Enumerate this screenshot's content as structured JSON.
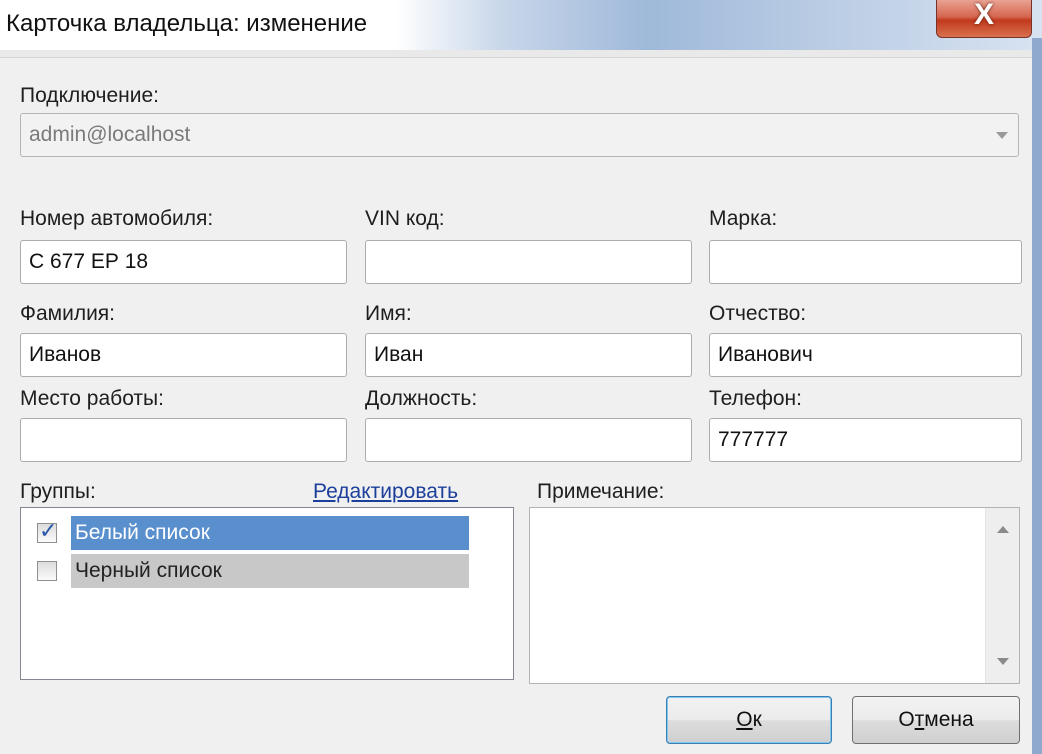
{
  "window": {
    "title": "Карточка владельца: изменение",
    "close_glyph": "X"
  },
  "connection": {
    "label": "Подключение:",
    "value": "admin@localhost"
  },
  "fields": {
    "car_number": {
      "label": "Номер автомобиля:",
      "value": "С 677 ЕР 18"
    },
    "vin": {
      "label": "VIN код:",
      "value": ""
    },
    "brand": {
      "label": "Марка:",
      "value": ""
    },
    "last_name": {
      "label": "Фамилия:",
      "value": "Иванов"
    },
    "first_name": {
      "label": "Имя:",
      "value": "Иван"
    },
    "patronymic": {
      "label": "Отчество:",
      "value": "Иванович"
    },
    "workplace": {
      "label": "Место работы:",
      "value": ""
    },
    "position": {
      "label": "Должность:",
      "value": ""
    },
    "phone": {
      "label": "Телефон:",
      "value": "777777"
    }
  },
  "groups": {
    "label": "Группы:",
    "edit_link": "Редактировать",
    "items": [
      {
        "label": "Белый список",
        "checked": true
      },
      {
        "label": "Черный список",
        "checked": false
      }
    ]
  },
  "notes": {
    "label": "Примечание:",
    "value": ""
  },
  "buttons": {
    "ok": {
      "mnemonic": "О",
      "rest": "к"
    },
    "cancel": {
      "prefix": "О",
      "mnemonic": "т",
      "rest": "мена"
    }
  },
  "colors": {
    "selection": "#5a8fce",
    "link": "#1c3f9b",
    "close": "#c13a1d"
  }
}
